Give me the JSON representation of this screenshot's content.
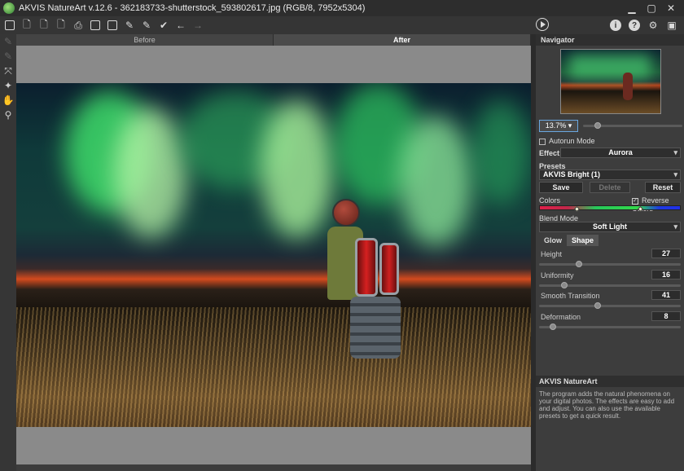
{
  "window": {
    "title": "AKVIS NatureArt v.12.6 - 362183733-shutterstock_593802617.jpg (RGB/8, 7952x5304)",
    "buttons": [
      "minimize-icon",
      "maximize-icon",
      "close-icon"
    ]
  },
  "toolbar": {
    "left_icons": [
      "home-icon",
      "open-icon",
      "save-icon",
      "export-icon",
      "print-icon",
      "batch-icon",
      "share-icon",
      "brush-icon",
      "brush-alt-icon",
      "presets-icon",
      "undo-icon",
      "redo-icon"
    ],
    "right_icons": [
      "info-icon",
      "help-icon",
      "settings-icon",
      "notifications-icon"
    ],
    "run_icon": "play-icon"
  },
  "tools": [
    "eraser-icon",
    "brush-icon",
    "transform-icon",
    "color-icon",
    "hand-icon",
    "zoom-icon"
  ],
  "tabs": {
    "before": "Before",
    "after": "After"
  },
  "navigator": {
    "title": "Navigator",
    "zoom": "13.7%",
    "zoom_value": 13.7
  },
  "settings": {
    "autorun_label": "Autorun Mode",
    "autorun_checked": false,
    "effect_label": "Effect:",
    "effect_value": "Aurora",
    "presets_label": "Presets",
    "preset_value": "AKVIS Bright (1)",
    "save_label": "Save",
    "delete_label": "Delete",
    "reset_label": "Reset",
    "colors_label": "Colors",
    "reverse_colors_label": "Reverse Colors",
    "reverse_colors_checked": true,
    "blend_mode_label": "Blend Mode",
    "blend_mode_value": "Soft Light",
    "tabs": {
      "glow": "Glow",
      "shape": "Shape"
    },
    "params": [
      {
        "label": "Height",
        "value": "27",
        "fraction": 0.27
      },
      {
        "label": "Uniformity",
        "value": "16",
        "fraction": 0.16
      },
      {
        "label": "Smooth Transition",
        "value": "41",
        "fraction": 0.41
      },
      {
        "label": "Deformation",
        "value": "8",
        "fraction": 0.08
      }
    ]
  },
  "info": {
    "title": "AKVIS NatureArt",
    "text": "The program adds the natural phenomena on your digital photos. The effects are easy to add and adjust. You can also use the available presets to get a quick result."
  }
}
